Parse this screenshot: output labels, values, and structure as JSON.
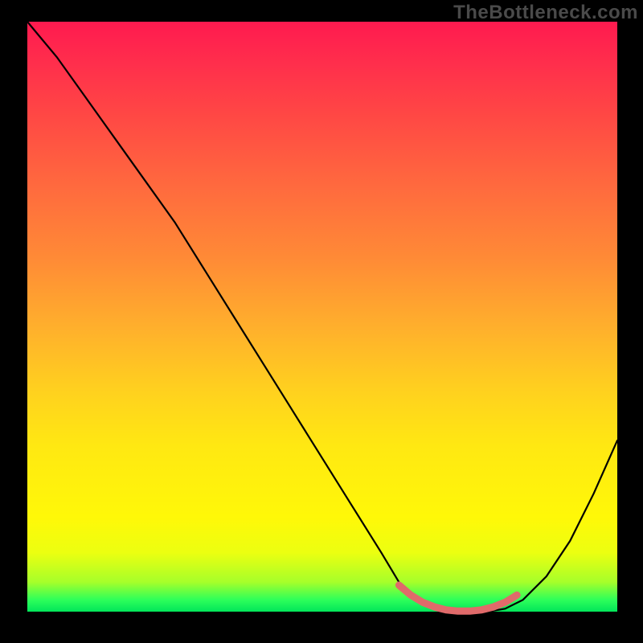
{
  "watermark": "TheBottleneck.com",
  "chart_data": {
    "type": "line",
    "title": "",
    "xlabel": "",
    "ylabel": "",
    "xlim": [
      0,
      100
    ],
    "ylim": [
      0,
      100
    ],
    "series": [
      {
        "name": "bottleneck-curve",
        "color": "#000000",
        "x": [
          0,
          5,
          10,
          15,
          20,
          25,
          30,
          35,
          40,
          45,
          50,
          55,
          60,
          63,
          66,
          69,
          72,
          75,
          78,
          81,
          84,
          88,
          92,
          96,
          100
        ],
        "y": [
          100,
          94,
          87,
          80,
          73,
          66,
          58,
          50,
          42,
          34,
          26,
          18,
          10,
          5,
          2,
          0.5,
          0,
          0,
          0,
          0.5,
          2,
          6,
          12,
          20,
          29
        ]
      },
      {
        "name": "optimal-highlight",
        "color": "#e06a6a",
        "x": [
          63,
          65,
          67,
          69,
          71,
          73,
          75,
          77,
          79,
          81,
          83
        ],
        "y": [
          4.5,
          2.8,
          1.6,
          0.8,
          0.3,
          0.1,
          0.1,
          0.3,
          0.8,
          1.6,
          2.8
        ]
      }
    ],
    "gradient_stops": [
      {
        "pos": 0,
        "color": "#ff1a4f"
      },
      {
        "pos": 50,
        "color": "#ffb02c"
      },
      {
        "pos": 85,
        "color": "#fff808"
      },
      {
        "pos": 100,
        "color": "#02e55a"
      }
    ],
    "grid": false,
    "legend": false
  }
}
